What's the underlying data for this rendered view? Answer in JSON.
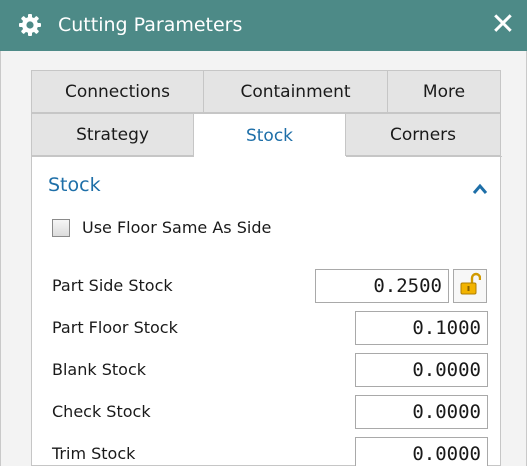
{
  "window": {
    "title": "Cutting Parameters",
    "close_glyph": "✕",
    "accent": "#4d8a87"
  },
  "tabs": {
    "row1": [
      {
        "label": "Connections",
        "active": false
      },
      {
        "label": "Containment",
        "active": false
      },
      {
        "label": "More",
        "active": false
      }
    ],
    "row2": [
      {
        "label": "Strategy",
        "active": false
      },
      {
        "label": "Stock",
        "active": true
      },
      {
        "label": "Corners",
        "active": false
      }
    ]
  },
  "section": {
    "title": "Stock",
    "title_color": "#1e6fa8",
    "collapse_icon": "chevron-up-icon"
  },
  "options": {
    "use_floor_same_as_side": {
      "label": "Use Floor Same As Side",
      "checked": false
    }
  },
  "fields": [
    {
      "label": "Part Side Stock",
      "value": "0.2500",
      "locked": false
    },
    {
      "label": "Part Floor Stock",
      "value": "0.1000"
    },
    {
      "label": "Blank Stock",
      "value": "0.0000"
    },
    {
      "label": "Check Stock",
      "value": "0.0000"
    },
    {
      "label": "Trim Stock",
      "value": "0.0000"
    }
  ],
  "icons": {
    "title": "gear-icon",
    "lock": "unlocked-padlock-icon",
    "lock_color": "#f2b300"
  }
}
